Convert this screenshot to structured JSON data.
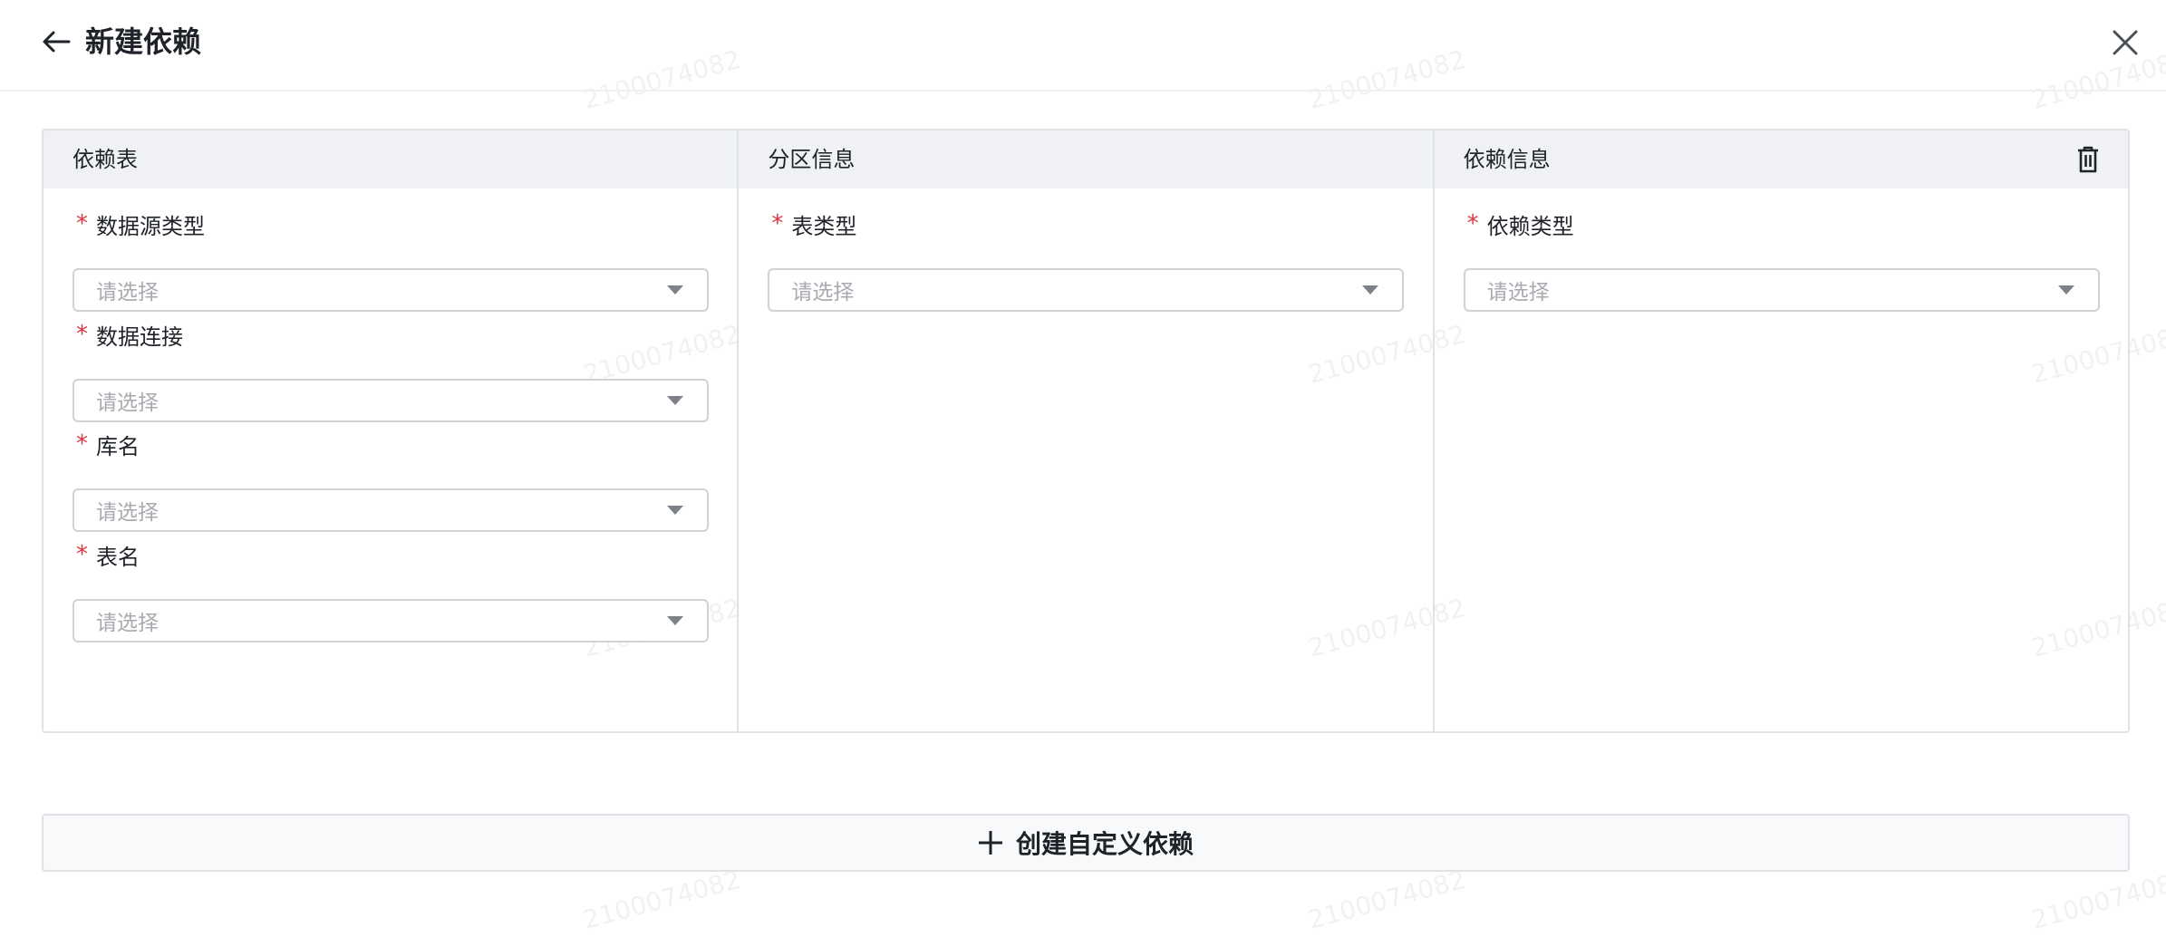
{
  "header": {
    "title": "新建依赖",
    "back_icon": "arrow-left-icon",
    "close_icon": "close-icon"
  },
  "panels": [
    {
      "title": "依赖表",
      "fields": [
        {
          "label": "数据源类型",
          "required": true,
          "placeholder": "请选择",
          "value": ""
        },
        {
          "label": "数据连接",
          "required": true,
          "placeholder": "请选择",
          "value": ""
        },
        {
          "label": "库名",
          "required": true,
          "placeholder": "请选择",
          "value": ""
        },
        {
          "label": "表名",
          "required": true,
          "placeholder": "请选择",
          "value": ""
        }
      ]
    },
    {
      "title": "分区信息",
      "fields": [
        {
          "label": "表类型",
          "required": true,
          "placeholder": "请选择",
          "value": ""
        }
      ]
    },
    {
      "title": "依赖信息",
      "action_icon": "trash-icon",
      "fields": [
        {
          "label": "依赖类型",
          "required": true,
          "placeholder": "请选择",
          "value": ""
        }
      ]
    }
  ],
  "required_mark": "*",
  "create_button": {
    "label": "创建自定义依赖",
    "icon": "plus-icon"
  },
  "watermark": {
    "text": "2100074082"
  },
  "colors": {
    "required": "#d9363e",
    "panel_header_bg": "#f0f1f4",
    "border": "#dfe2e6",
    "placeholder": "#a7abb0"
  }
}
